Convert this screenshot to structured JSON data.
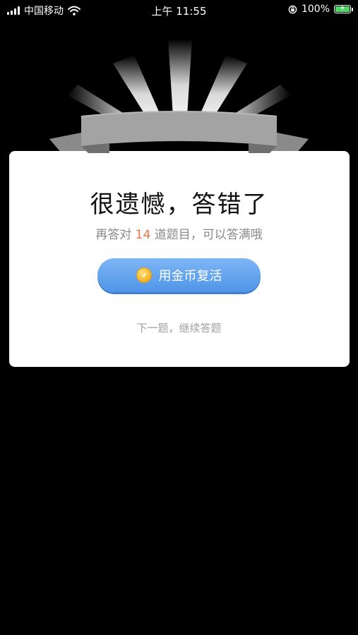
{
  "status_bar": {
    "carrier": "中国移动",
    "time": "上午 11:55",
    "battery_percent": "100%",
    "icons": [
      "signal-icon",
      "wifi-icon",
      "orientation-lock-icon",
      "battery-icon"
    ]
  },
  "dialog": {
    "title": "很遗憾，答错了",
    "subtitle_prefix": "再答对",
    "subtitle_number": "14",
    "subtitle_suffix": "道题目，可以答满哦",
    "revive_button_label": "用金币复活",
    "revive_icon": "coin-icon",
    "next_link_label": "下一题，继续答题"
  },
  "colors": {
    "background": "#000000",
    "card": "#ffffff",
    "button": "#5a9ef0",
    "highlight_number": "#e8764a",
    "ribbon": "#9a9a9a"
  }
}
